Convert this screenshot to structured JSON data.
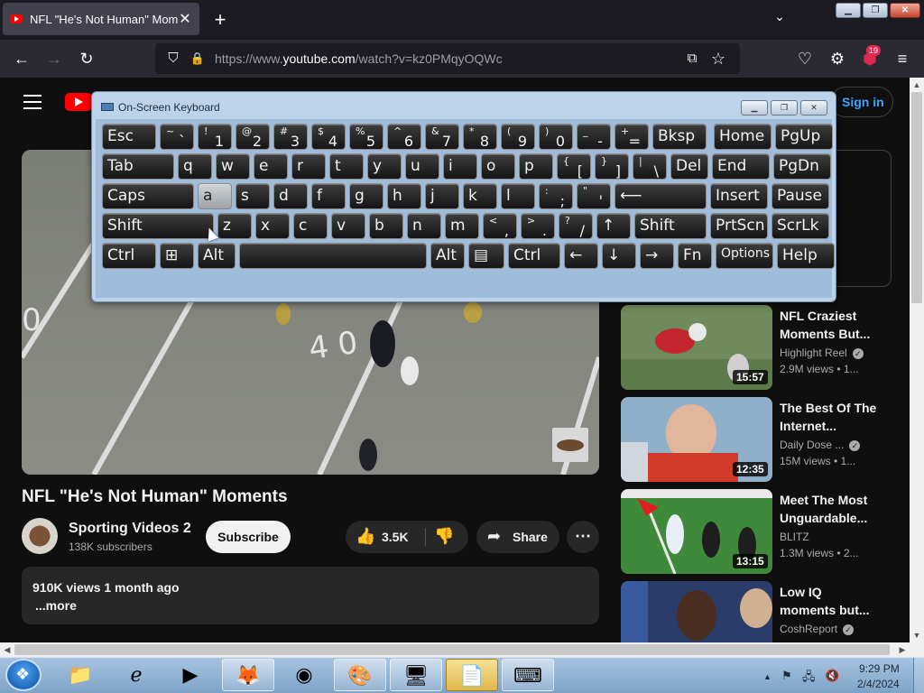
{
  "browser": {
    "tab_title": "NFL \"He's Not Human\" Moments",
    "tab_close": "✕",
    "new_tab": "+",
    "list_tabs": "⌄",
    "url_prefix": "https://www.",
    "url_host": "youtube.com",
    "url_path": "/watch?v=kz0PMqyOQWc",
    "extensions_badge": "19",
    "window_buttons": {
      "minimize": "▁",
      "maximize": "❐",
      "close": "✕"
    },
    "nav": {
      "back": "←",
      "forward": "→",
      "reload": "↻",
      "shield": "⛉",
      "lock": "🔒",
      "pip": "⧉",
      "bookmark": "☆",
      "pocket": "♡",
      "extensions": "⚙",
      "menu": "≡"
    }
  },
  "youtube": {
    "sign_in": "Sign in",
    "video_title": "NFL \"He's Not Human\" Moments",
    "channel_name": "Sporting Videos 2",
    "subscribers": "138K subscribers",
    "subscribe": "Subscribe",
    "likes": "3.5K",
    "share": "Share",
    "more": "⋯",
    "views_meta": "910K views  1 month ago",
    "desc_more": "...more",
    "like_icon": "👍",
    "dislike_icon": "👎",
    "share_icon": "➦"
  },
  "recommendations": [
    {
      "title": "NFL Craziest Moments But...",
      "channel": "Highlight Reel",
      "meta": "2.9M views  • 1...",
      "duration": "15:57"
    },
    {
      "title": "The Best Of The Internet...",
      "channel": "Daily Dose ...",
      "meta": "15M views  • 1...",
      "duration": "12:35"
    },
    {
      "title": "Meet The Most Unguardable...",
      "channel": "BLITZ",
      "meta": "1.3M views  • 2...",
      "duration": "13:15"
    },
    {
      "title": "Low IQ moments but...",
      "channel": "CoshReport",
      "meta": "",
      "duration": ""
    }
  ],
  "osk": {
    "title": "On-Screen Keyboard",
    "btn_min": "▁",
    "btn_max": "❐",
    "btn_close": "✕",
    "rows": [
      [
        {
          "label": "Esc"
        },
        {
          "top": "~",
          "main": "`"
        },
        {
          "top": "!",
          "main": "1"
        },
        {
          "top": "@",
          "main": "2"
        },
        {
          "top": "#",
          "main": "3"
        },
        {
          "top": "$",
          "main": "4"
        },
        {
          "top": "%",
          "main": "5"
        },
        {
          "top": "^",
          "main": "6"
        },
        {
          "top": "&",
          "main": "7"
        },
        {
          "top": "*",
          "main": "8"
        },
        {
          "top": "(",
          "main": "9"
        },
        {
          "top": ")",
          "main": "0"
        },
        {
          "top": "_",
          "main": "-"
        },
        {
          "top": "+",
          "main": "="
        },
        {
          "label": "Bksp"
        },
        {
          "label": "Home"
        },
        {
          "label": "PgUp"
        }
      ],
      [
        {
          "label": "Tab"
        },
        {
          "label": "q"
        },
        {
          "label": "w"
        },
        {
          "label": "e"
        },
        {
          "label": "r"
        },
        {
          "label": "t"
        },
        {
          "label": "y"
        },
        {
          "label": "u"
        },
        {
          "label": "i"
        },
        {
          "label": "o"
        },
        {
          "label": "p"
        },
        {
          "top": "{",
          "main": "["
        },
        {
          "top": "}",
          "main": "]"
        },
        {
          "top": "|",
          "main": "\\"
        },
        {
          "label": "Del"
        },
        {
          "label": "End"
        },
        {
          "label": "PgDn"
        }
      ],
      [
        {
          "label": "Caps"
        },
        {
          "label": "a"
        },
        {
          "label": "s"
        },
        {
          "label": "d"
        },
        {
          "label": "f"
        },
        {
          "label": "g"
        },
        {
          "label": "h"
        },
        {
          "label": "j"
        },
        {
          "label": "k"
        },
        {
          "label": "l"
        },
        {
          "top": ":",
          "main": ";"
        },
        {
          "top": "\"",
          "main": "'"
        },
        {
          "label": "⟵"
        },
        {
          "label": "Insert"
        },
        {
          "label": "Pause"
        }
      ],
      [
        {
          "label": "Shift"
        },
        {
          "label": "z"
        },
        {
          "label": "x"
        },
        {
          "label": "c"
        },
        {
          "label": "v"
        },
        {
          "label": "b"
        },
        {
          "label": "n"
        },
        {
          "label": "m"
        },
        {
          "top": "<",
          "main": ","
        },
        {
          "top": ">",
          "main": "."
        },
        {
          "top": "?",
          "main": "/"
        },
        {
          "label": "↑"
        },
        {
          "label": "Shift"
        },
        {
          "label": "PrtScn"
        },
        {
          "label": "ScrLk"
        }
      ],
      [
        {
          "label": "Ctrl"
        },
        {
          "label": "⊞"
        },
        {
          "label": "Alt"
        },
        {
          "label": ""
        },
        {
          "label": "Alt"
        },
        {
          "label": "▤"
        },
        {
          "label": "Ctrl"
        },
        {
          "label": "←"
        },
        {
          "label": "↓"
        },
        {
          "label": "→"
        },
        {
          "label": "Fn"
        },
        {
          "label": "Options"
        },
        {
          "label": "Help"
        }
      ]
    ]
  },
  "taskbar": {
    "clock_time": "9:29 PM",
    "clock_date": "2/4/2024",
    "tray": {
      "chevron": "▲",
      "flag": "⚑",
      "network": "🖧",
      "volume": "🔇"
    },
    "apps": [
      {
        "name": "explorer",
        "glyph": "📁",
        "open": false
      },
      {
        "name": "internet-explorer",
        "glyph": "ℯ",
        "open": false
      },
      {
        "name": "media-player",
        "glyph": "▶",
        "open": false
      },
      {
        "name": "firefox",
        "glyph": "🦊",
        "open": true
      },
      {
        "name": "app-green",
        "glyph": "◉",
        "open": false
      },
      {
        "name": "paint",
        "glyph": "🎨",
        "open": true
      },
      {
        "name": "control-panel",
        "glyph": "🖥",
        "open": true
      },
      {
        "name": "file-app",
        "glyph": "📄",
        "open": true,
        "active": true
      },
      {
        "name": "on-screen-keyboard",
        "glyph": "⌨",
        "open": true
      }
    ]
  }
}
